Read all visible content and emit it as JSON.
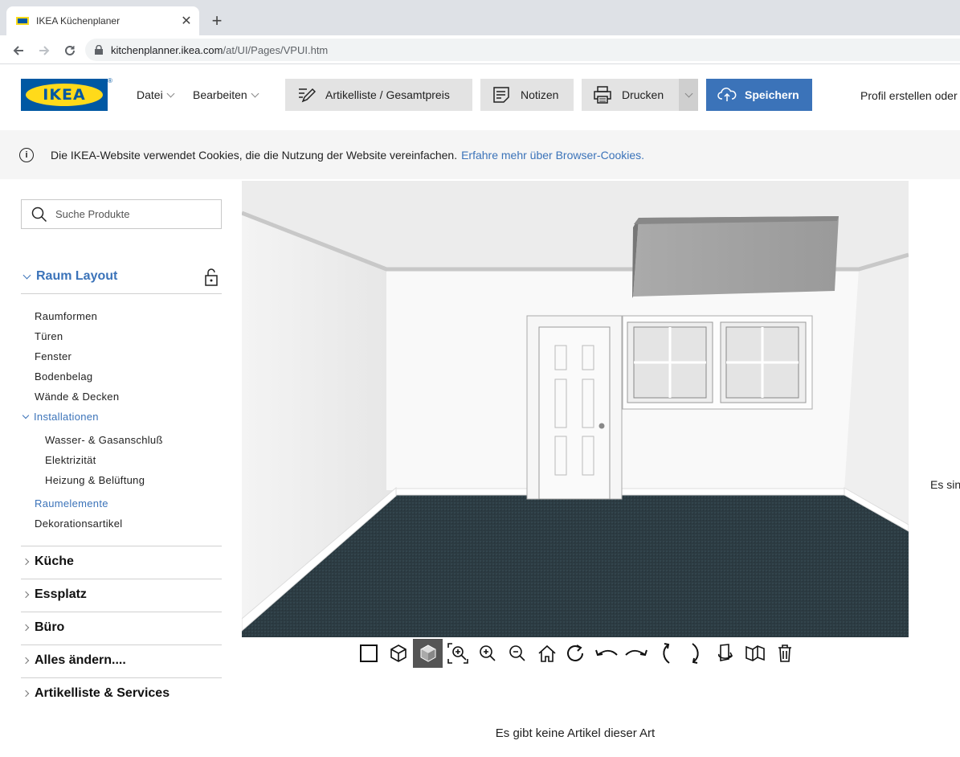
{
  "browser": {
    "tab_title": "IKEA Küchenplaner",
    "url_host": "kitchenplanner.ikea.com",
    "url_path": "/at/UI/Pages/VPUI.htm"
  },
  "header": {
    "logo_text": "IKEA",
    "menu": [
      {
        "label": "Datei"
      },
      {
        "label": "Bearbeiten"
      }
    ],
    "buttons": {
      "article_list": "Artikelliste / Gesamtpreis",
      "notes": "Notizen",
      "print": "Drucken",
      "save": "Speichern"
    },
    "profile": "Profil erstellen oder"
  },
  "cookie": {
    "text": "Die IKEA-Website verwendet Cookies, die die Nutzung der Website vereinfachen.",
    "link": "Erfahre mehr über Browser-Cookies."
  },
  "sidebar": {
    "search_placeholder": "Suche Produkte",
    "raum_layout": "Raum Layout",
    "items": [
      "Raumformen",
      "Türen",
      "Fenster",
      "Bodenbelag",
      "Wände & Decken"
    ],
    "installationen": "Installationen",
    "sub_items": [
      "Wasser- & Gasanschluß",
      "Elektrizität",
      "Heizung & Belüftung"
    ],
    "raumelemente": "Raumelemente",
    "dekoration": "Dekorationsartikel",
    "sections": [
      "Küche",
      "Essplatz",
      "Büro",
      "Alles ändern....",
      "Artikelliste & Services"
    ]
  },
  "main": {
    "empty_text": "Es gibt keine Artikel dieser Art",
    "right_text": "Es sin"
  },
  "toolbar": {
    "tools": [
      "2d-view-icon",
      "3d-box-icon",
      "3d-solid-icon",
      "zoom-area-icon",
      "zoom-in-icon",
      "zoom-out-icon",
      "home-icon",
      "rotate-cw-icon",
      "rotate-left-icon",
      "rotate-right-icon",
      "tilt-up-icon",
      "tilt-down-icon",
      "wall-view-icon",
      "room-view-icon",
      "trash-icon"
    ],
    "active_tool": "3d-solid-icon"
  },
  "colors": {
    "ikea_blue": "#0058a3",
    "ikea_yellow": "#ffda1a",
    "accent": "#3b73b9",
    "floor": "#2c3b42"
  }
}
